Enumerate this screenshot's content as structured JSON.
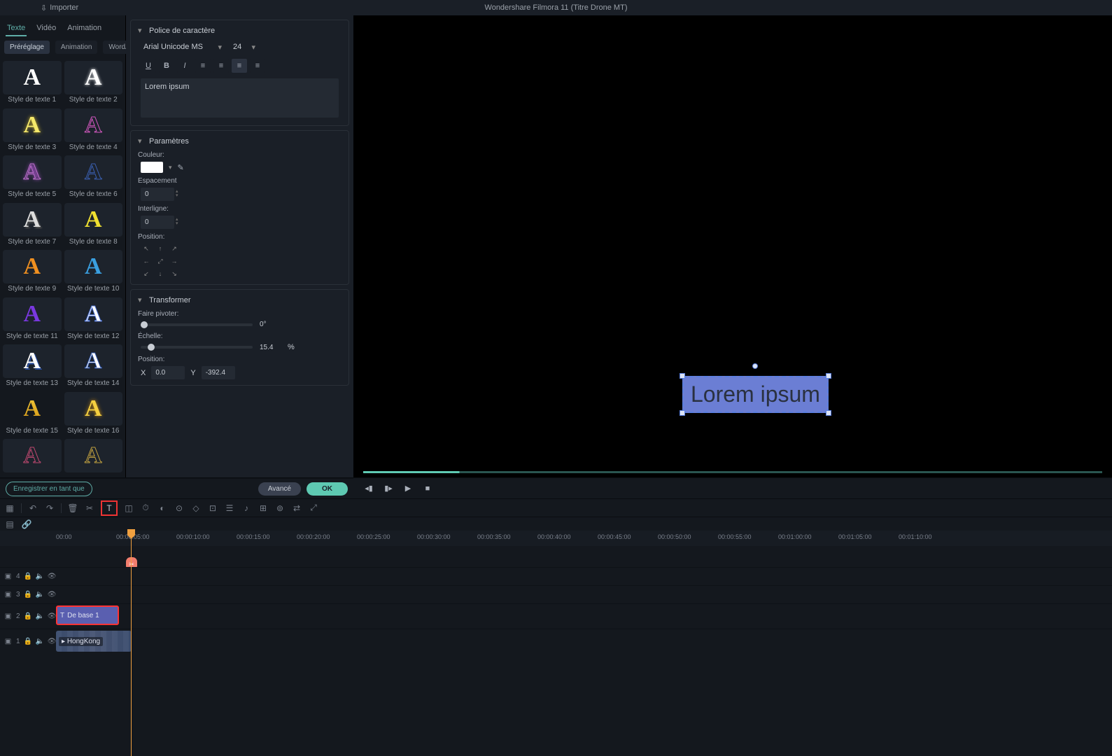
{
  "app": {
    "title": "Wondershare Filmora 11 (Titre Drone MT)",
    "import": "Importer"
  },
  "tabs": {
    "texte": "Texte",
    "video": "Vidéo",
    "animation": "Animation"
  },
  "subtabs": {
    "prereglage": "Préréglage",
    "animation": "Animation",
    "wordart": "WordArt"
  },
  "styles": [
    {
      "label": "Style de texte 1"
    },
    {
      "label": "Style de texte 2"
    },
    {
      "label": "Style de texte 3"
    },
    {
      "label": "Style de texte 4"
    },
    {
      "label": "Style de texte 5"
    },
    {
      "label": "Style de texte 6"
    },
    {
      "label": "Style de texte 7"
    },
    {
      "label": "Style de texte 8"
    },
    {
      "label": "Style de texte 9"
    },
    {
      "label": "Style de texte 10"
    },
    {
      "label": "Style de texte 11"
    },
    {
      "label": "Style de texte 12"
    },
    {
      "label": "Style de texte 13"
    },
    {
      "label": "Style de texte 14"
    },
    {
      "label": "Style de texte 15"
    },
    {
      "label": "Style de texte 16"
    }
  ],
  "police": {
    "header": "Police de caractère",
    "font": "Arial Unicode MS",
    "size": "24",
    "text": "Lorem ipsum"
  },
  "param": {
    "header": "Paramètres",
    "couleur": "Couleur:",
    "espacement": "Espacement",
    "espacement_val": "0",
    "interligne": "Interligne:",
    "interligne_val": "0",
    "position": "Position:"
  },
  "transformer": {
    "header": "Transformer",
    "rotate": "Faire pivoter:",
    "rotate_val": "0°",
    "scale": "Échelle:",
    "scale_val": "15.4",
    "scale_unit": "%",
    "pos": "Position:",
    "x": "X",
    "x_val": "0.0",
    "y": "Y",
    "y_val": "-392.4"
  },
  "actions": {
    "save": "Enregistrer en tant que",
    "adv": "Avancé",
    "ok": "OK"
  },
  "preview": {
    "text": "Lorem ipsum"
  },
  "timeline": {
    "ticks": [
      "00:00",
      "00:00:05:00",
      "00:00:10:00",
      "00:00:15:00",
      "00:00:20:00",
      "00:00:25:00",
      "00:00:30:00",
      "00:00:35:00",
      "00:00:40:00",
      "00:00:45:00",
      "00:00:50:00",
      "00:00:55:00",
      "00:01:00:00",
      "00:01:05:00",
      "00:01:10:00"
    ],
    "tracks": [
      "4",
      "3",
      "2",
      "1"
    ],
    "clip_text": "De base 1",
    "clip_video": "HongKong"
  }
}
